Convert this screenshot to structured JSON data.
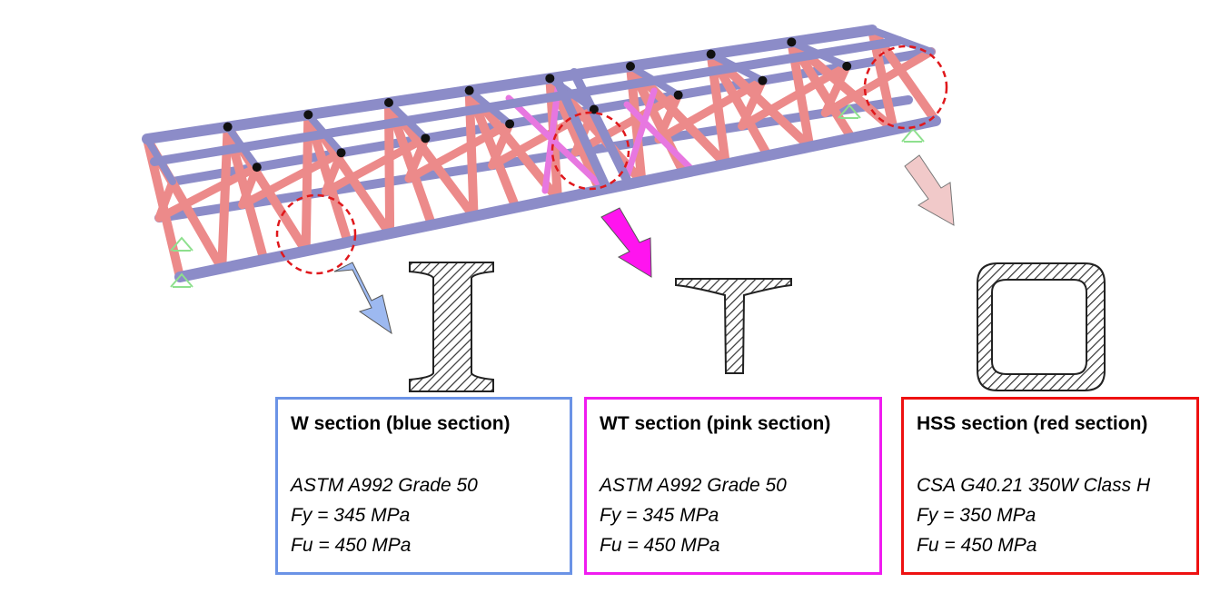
{
  "colors": {
    "blue_member": "#8c8cc8",
    "pink_member": "#e777e0",
    "red_member": "#ec8a8a",
    "support": "#8ee08e",
    "callout_circle": "#e0181c",
    "arrow_blue": "#9db9f0",
    "arrow_magenta": "#ff14ef",
    "arrow_pink": "#f1c9c9",
    "border_w": "#6b93e6",
    "border_wt": "#f01cf0",
    "border_hss": "#ee1111"
  },
  "sections": [
    {
      "id": "w",
      "shape": "i-beam",
      "title": "W section (blue section)",
      "material": "ASTM A992 Grade 50",
      "fy": "Fy = 345 MPa",
      "fu": "Fu = 450 MPa"
    },
    {
      "id": "wt",
      "shape": "tee",
      "title": "WT section (pink section)",
      "material": "ASTM A992 Grade 50",
      "fy": "Fy = 345 MPa",
      "fu": "Fu = 450 MPa"
    },
    {
      "id": "hss",
      "shape": "hollow-square",
      "title": "HSS section (red section)",
      "material": "CSA G40.21 350W Class H",
      "fy": "Fy = 350 MPa",
      "fu": "Fu = 450 MPa"
    }
  ]
}
